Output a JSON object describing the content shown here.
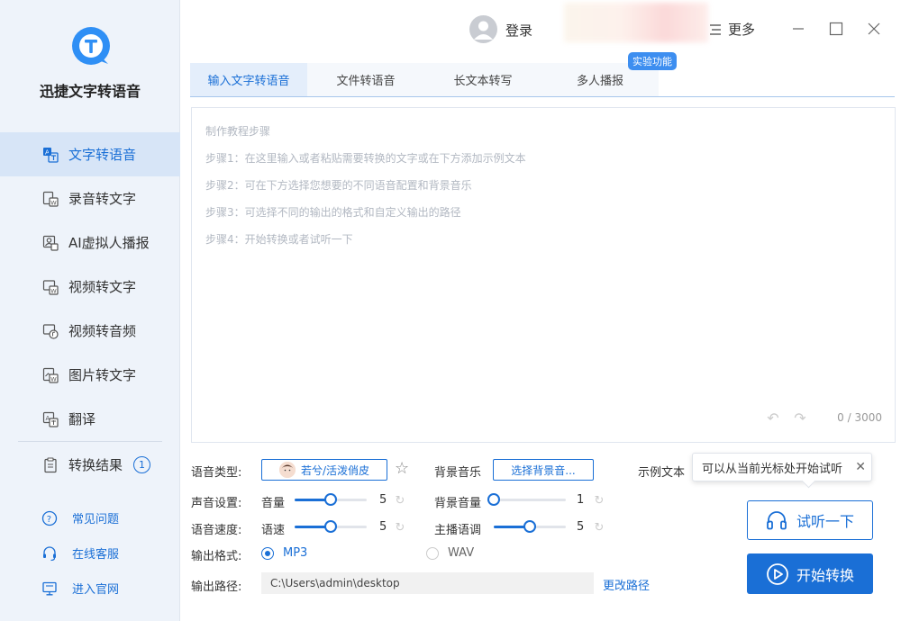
{
  "app": {
    "name": "迅捷文字转语音"
  },
  "colors": {
    "accent": "#1a6fd6",
    "sidebar_bg": "#eef3fa",
    "active_nav_bg": "#d7e5f7"
  },
  "sidebar": {
    "items": [
      {
        "label": "文字转语音",
        "icon": "text-to-speech-icon"
      },
      {
        "label": "录音转文字",
        "icon": "recording-to-text-icon"
      },
      {
        "label": "AI虚拟人播报",
        "icon": "ai-avatar-icon"
      },
      {
        "label": "视频转文字",
        "icon": "video-to-text-icon"
      },
      {
        "label": "视频转音频",
        "icon": "video-to-audio-icon"
      },
      {
        "label": "图片转文字",
        "icon": "image-to-text-icon"
      },
      {
        "label": "翻译",
        "icon": "translate-icon"
      }
    ],
    "result": {
      "label": "转换结果",
      "count": "1"
    },
    "links": [
      {
        "label": "常见问题",
        "icon": "question-icon"
      },
      {
        "label": "在线客服",
        "icon": "headset-icon"
      },
      {
        "label": "进入官网",
        "icon": "monitor-icon"
      }
    ]
  },
  "header": {
    "login": "登录",
    "more": "更多"
  },
  "tabs": {
    "items": [
      "输入文字转语音",
      "文件转语音",
      "长文本转写",
      "多人播报"
    ],
    "active_index": 0,
    "exp_tag": "实验功能"
  },
  "editor": {
    "hints": [
      "制作教程步骤",
      "步骤1：在这里输入或者粘贴需要转换的文字或在下方添加示例文本",
      "步骤2：可在下方选择您想要的不同语音配置和背景音乐",
      "步骤3：可选择不同的输出的格式和自定义输出的路径",
      "步骤4：开始转换或者试听一下"
    ],
    "counter": "0 / 3000"
  },
  "settings": {
    "voice_type_label": "语音类型:",
    "voice_name": "若兮/活泼俏皮",
    "bgm_label": "背景音乐",
    "bgm_button": "选择背景音...",
    "sample_text": "示例文本",
    "sound_label": "声音设置:",
    "volume_label": "音量",
    "volume_value": "5",
    "bg_volume_label": "背景音量",
    "bg_volume_value": "1",
    "speed_label": "语音速度:",
    "speed_sub": "语速",
    "speed_value": "5",
    "pitch_label": "主播语调",
    "pitch_value": "5",
    "format_label": "输出格式:",
    "format_options": [
      "MP3",
      "WAV"
    ],
    "format_selected": "MP3",
    "path_label": "输出路径:",
    "path_value": "C:\\Users\\admin\\desktop",
    "change_path": "更改路径",
    "volume_fraction": 0.5,
    "bg_volume_fraction": 0.0,
    "speed_fraction": 0.5,
    "pitch_fraction": 0.5
  },
  "tooltip": {
    "text": "可以从当前光标处开始试听"
  },
  "actions": {
    "listen": "试听一下",
    "start": "开始转换"
  }
}
